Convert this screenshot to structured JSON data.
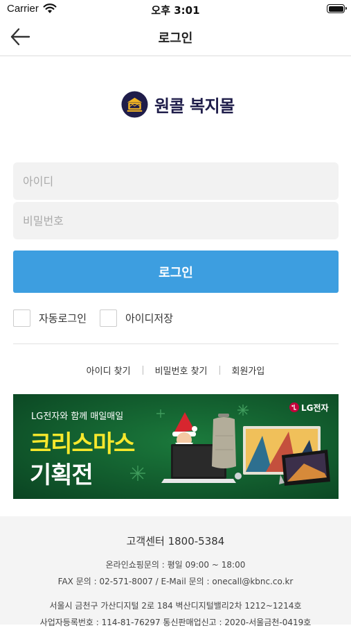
{
  "status_bar": {
    "carrier": "Carrier",
    "time": "오후 3:01"
  },
  "nav": {
    "title": "로그인"
  },
  "logo": {
    "text": "원콜 복지몰"
  },
  "form": {
    "id_placeholder": "아이디",
    "pw_placeholder": "비밀번호",
    "login_button": "로그인",
    "auto_login_label": "자동로그인",
    "save_id_label": "아이디저장"
  },
  "links": {
    "find_id": "아이디 찾기",
    "find_pw": "비밀번호 찾기",
    "signup": "회원가입"
  },
  "banner": {
    "brand": "LG전자",
    "subtitle": "LG전자와 함께 매일매일",
    "headline1": "크리스마스",
    "headline2": "기획전"
  },
  "footer": {
    "cs_center": "고객센터 1800-5384",
    "hours": "온라인쇼핑문의 : 평일 09:00 ~ 18:00",
    "fax_email": "FAX 문의 : 02-571-8007 / E-Mail 문의 : onecall@kbnc.co.kr",
    "address": "서울시 금천구 가산디지털 2로 184 벽산디지털밸리2차 1212~1214호",
    "biz_no": "사업자등록번호 : 114-81-76297 통신판매업신고 : 2020-서울금천-0419호"
  },
  "colors": {
    "accent": "#3d9ee0",
    "banner_bg": "#0f5a2e",
    "headline": "#f7e82c",
    "brand_red": "#c4003b",
    "logo_navy": "#1f1d4a"
  }
}
